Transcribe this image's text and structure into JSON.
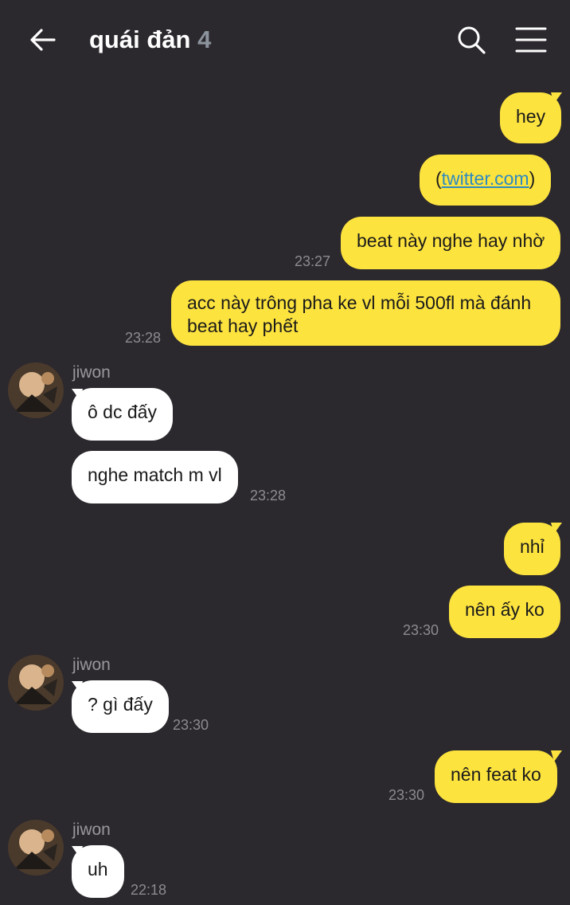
{
  "header": {
    "title": "quái đản",
    "member_count": "4"
  },
  "messages": {
    "m1": {
      "text": "hey"
    },
    "m2": {
      "prefix": "(",
      "link": "twitter.com",
      "suffix": ")"
    },
    "m3": {
      "text": "beat này nghe hay nhờ",
      "time": "23:27"
    },
    "m4": {
      "line1": "acc này trông pha ke vl mỗi 500fl mà đánh",
      "line2": "beat hay phết",
      "time": "23:28"
    },
    "m5": {
      "sender": "jiwon",
      "text": "ô dc đấy"
    },
    "m6": {
      "text": "nghe match m vl",
      "time": "23:28"
    },
    "m7": {
      "text": "nhỉ"
    },
    "m8": {
      "text": "nên ấy ko",
      "time": "23:30"
    },
    "m9": {
      "sender": "jiwon",
      "text": "? gì đấy",
      "time": "23:30"
    },
    "m10": {
      "text": "nên feat ko",
      "time": "23:30"
    },
    "m11": {
      "sender": "jiwon",
      "text": "uh",
      "time": "22:18"
    }
  },
  "colors": {
    "background": "#2b282e",
    "outgoing_bubble": "#fde33e",
    "incoming_bubble": "#ffffff",
    "link": "#2e8bc0"
  },
  "icons": [
    "back-arrow-icon",
    "search-icon",
    "menu-icon",
    "avatar"
  ]
}
